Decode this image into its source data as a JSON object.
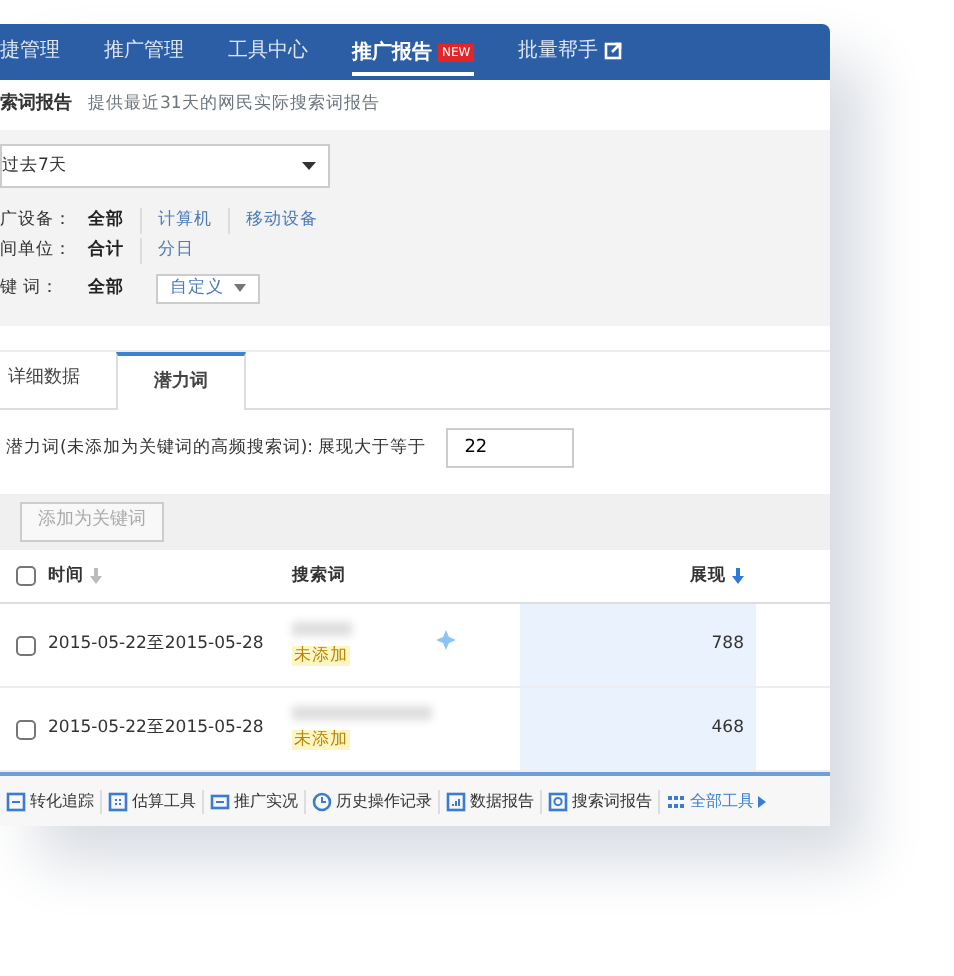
{
  "nav": {
    "items": [
      {
        "label": "捷管理",
        "selected": false
      },
      {
        "label": "推广管理",
        "selected": false
      },
      {
        "label": "工具中心",
        "selected": false
      },
      {
        "label": "推广报告",
        "selected": true,
        "badge": "NEW"
      },
      {
        "label": "批量帮手",
        "selected": false,
        "external": true
      }
    ]
  },
  "subheader": {
    "title": "索词报告",
    "description": "提供最近31天的网民实际搜索词报告"
  },
  "date_select": {
    "value": "过去7天"
  },
  "filters": [
    {
      "label": "广设备：",
      "options": [
        {
          "label": "全部",
          "kind": "link",
          "selected": true
        },
        {
          "label": "计算机",
          "kind": "link",
          "selected": false
        },
        {
          "label": "移动设备",
          "kind": "link",
          "selected": false
        }
      ]
    },
    {
      "label": "间单位：",
      "options": [
        {
          "label": "合计",
          "kind": "link",
          "selected": true
        },
        {
          "label": "分日",
          "kind": "link",
          "selected": false
        }
      ]
    },
    {
      "label": "键 词：",
      "options": [
        {
          "label": "全部",
          "kind": "link",
          "selected": true
        },
        {
          "label": "自定义",
          "kind": "dropdown",
          "selected": false
        }
      ]
    }
  ],
  "tabs": [
    {
      "label": "详细数据",
      "selected": false
    },
    {
      "label": "潜力词",
      "selected": true
    }
  ],
  "threshold": {
    "label": "潜力词(未添加为关键词的高频搜索词): 展现大于等于",
    "value": "22"
  },
  "add_button": {
    "label": "添加为关键词",
    "disabled": true
  },
  "table": {
    "header_checked": false,
    "columns": [
      {
        "label": "时间",
        "sort_active": false
      },
      {
        "label": "搜索词"
      },
      {
        "label": "展现",
        "sort_active": true
      }
    ],
    "rows": [
      {
        "checked": false,
        "time": "2015-05-22至2015-05-28",
        "status": "未添加",
        "impressions": "788"
      },
      {
        "checked": false,
        "time": "2015-05-22至2015-05-28",
        "status": "未添加",
        "impressions": "468"
      }
    ]
  },
  "tools": [
    {
      "label": "转化追踪",
      "kind": "square"
    },
    {
      "label": "估算工具",
      "kind": "grid"
    },
    {
      "label": "推广实况",
      "kind": "screen"
    },
    {
      "label": "历史操作记录",
      "kind": "clock"
    },
    {
      "label": "数据报告",
      "kind": "chart"
    },
    {
      "label": "搜索词报告",
      "kind": "search"
    },
    {
      "label": "全部工具",
      "kind": "all"
    }
  ]
}
